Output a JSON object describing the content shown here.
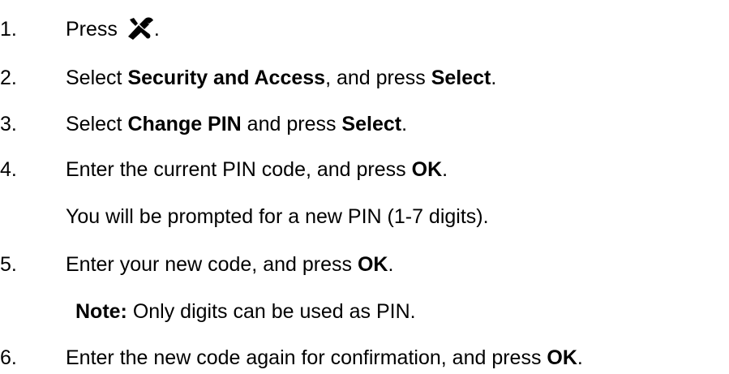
{
  "steps": [
    {
      "number": "1.",
      "pre": "Press ",
      "icon": "wrench-screwdriver-icon",
      "post": "."
    },
    {
      "number": "2.",
      "pre": "Select ",
      "bold1": "Security and Access",
      "mid": ", and press ",
      "bold2": "Select",
      "post": "."
    },
    {
      "number": "3.",
      "pre": "Select ",
      "bold1": "Change PIN",
      "mid": " and press ",
      "bold2": "Select",
      "post": "."
    },
    {
      "number": "4.",
      "pre": "Enter the current PIN code, and press ",
      "bold1": "OK",
      "post": ".",
      "continuation": "You will be prompted for a new PIN (1-7 digits)."
    },
    {
      "number": "5.",
      "pre": "Enter your new code, and press ",
      "bold1": "OK",
      "post": ".",
      "note_label": "Note:",
      "note_text": " Only digits can be used as PIN."
    },
    {
      "number": "6.",
      "pre": "Enter the new code again for confirmation, and press ",
      "bold1": "OK",
      "post": "."
    }
  ]
}
